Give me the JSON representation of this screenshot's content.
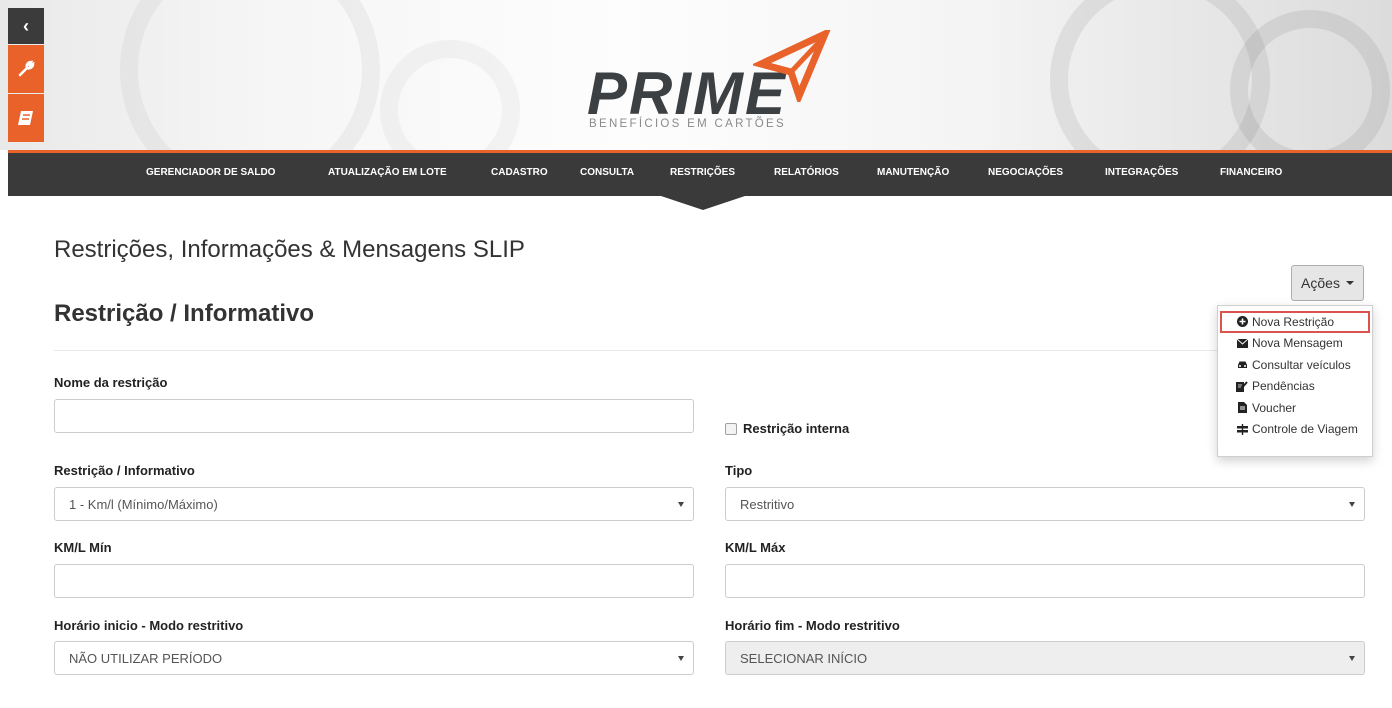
{
  "colors": {
    "brand_orange": "#e8622a",
    "nav_bg": "#3a3a3a",
    "highlight_red": "#d9534f"
  },
  "sidebar_tools": [
    {
      "icon": "chevron-left-icon",
      "glyph": "‹"
    },
    {
      "icon": "wrench-icon",
      "glyph": "🔧"
    },
    {
      "icon": "book-icon",
      "glyph": "▤"
    }
  ],
  "logo": {
    "name": "PRIME",
    "tagline": "BENEFÍCIOS EM CARTÕES"
  },
  "nav": {
    "items": [
      "GERENCIADOR DE SALDO",
      "ATUALIZAÇÃO EM LOTE",
      "CADASTRO",
      "CONSULTA",
      "RESTRIÇÕES",
      "RELATÓRIOS",
      "MANUTENÇÃO",
      "NEGOCIAÇÕES",
      "INTEGRAÇÕES",
      "FINANCEIRO"
    ],
    "active": "RESTRIÇÕES"
  },
  "page": {
    "title": "Restrições, Informações & Mensagens SLIP",
    "section_title": "Restrição / Informativo"
  },
  "actions": {
    "button_label": "Ações",
    "menu": [
      {
        "label": "Nova Restrição",
        "icon": "plus-circle-icon",
        "glyph": "⊕"
      },
      {
        "label": "Nova Mensagem",
        "icon": "envelope-icon",
        "glyph": "✉"
      },
      {
        "label": "Consultar veículos",
        "icon": "car-icon",
        "glyph": "🚗"
      },
      {
        "label": "Pendências",
        "icon": "edit-icon",
        "glyph": "✎"
      },
      {
        "label": "Voucher",
        "icon": "file-icon",
        "glyph": "▮"
      },
      {
        "label": "Controle de Viagem",
        "icon": "road-sign-icon",
        "glyph": "☰"
      }
    ]
  },
  "form": {
    "nome_label": "Nome da restrição",
    "nome_value": "",
    "restricao_interna_label": "Restrição interna",
    "restricao_interna_checked": false,
    "tipo_restricao_label": "Restrição / Informativo",
    "tipo_restricao_value": "1 - Km/l (Mínimo/Máximo)",
    "tipo_label": "Tipo",
    "tipo_value": "Restritivo",
    "kml_min_label": "KM/L Mín",
    "kml_min_value": "",
    "kml_max_label": "KM/L Máx",
    "kml_max_value": "",
    "horario_inicio_label": "Horário inicio - Modo restritivo",
    "horario_inicio_value": "NÃO UTILIZAR PERÍODO",
    "horario_fim_label": "Horário fim - Modo restritivo",
    "horario_fim_value": "SELECIONAR INÍCIO"
  }
}
